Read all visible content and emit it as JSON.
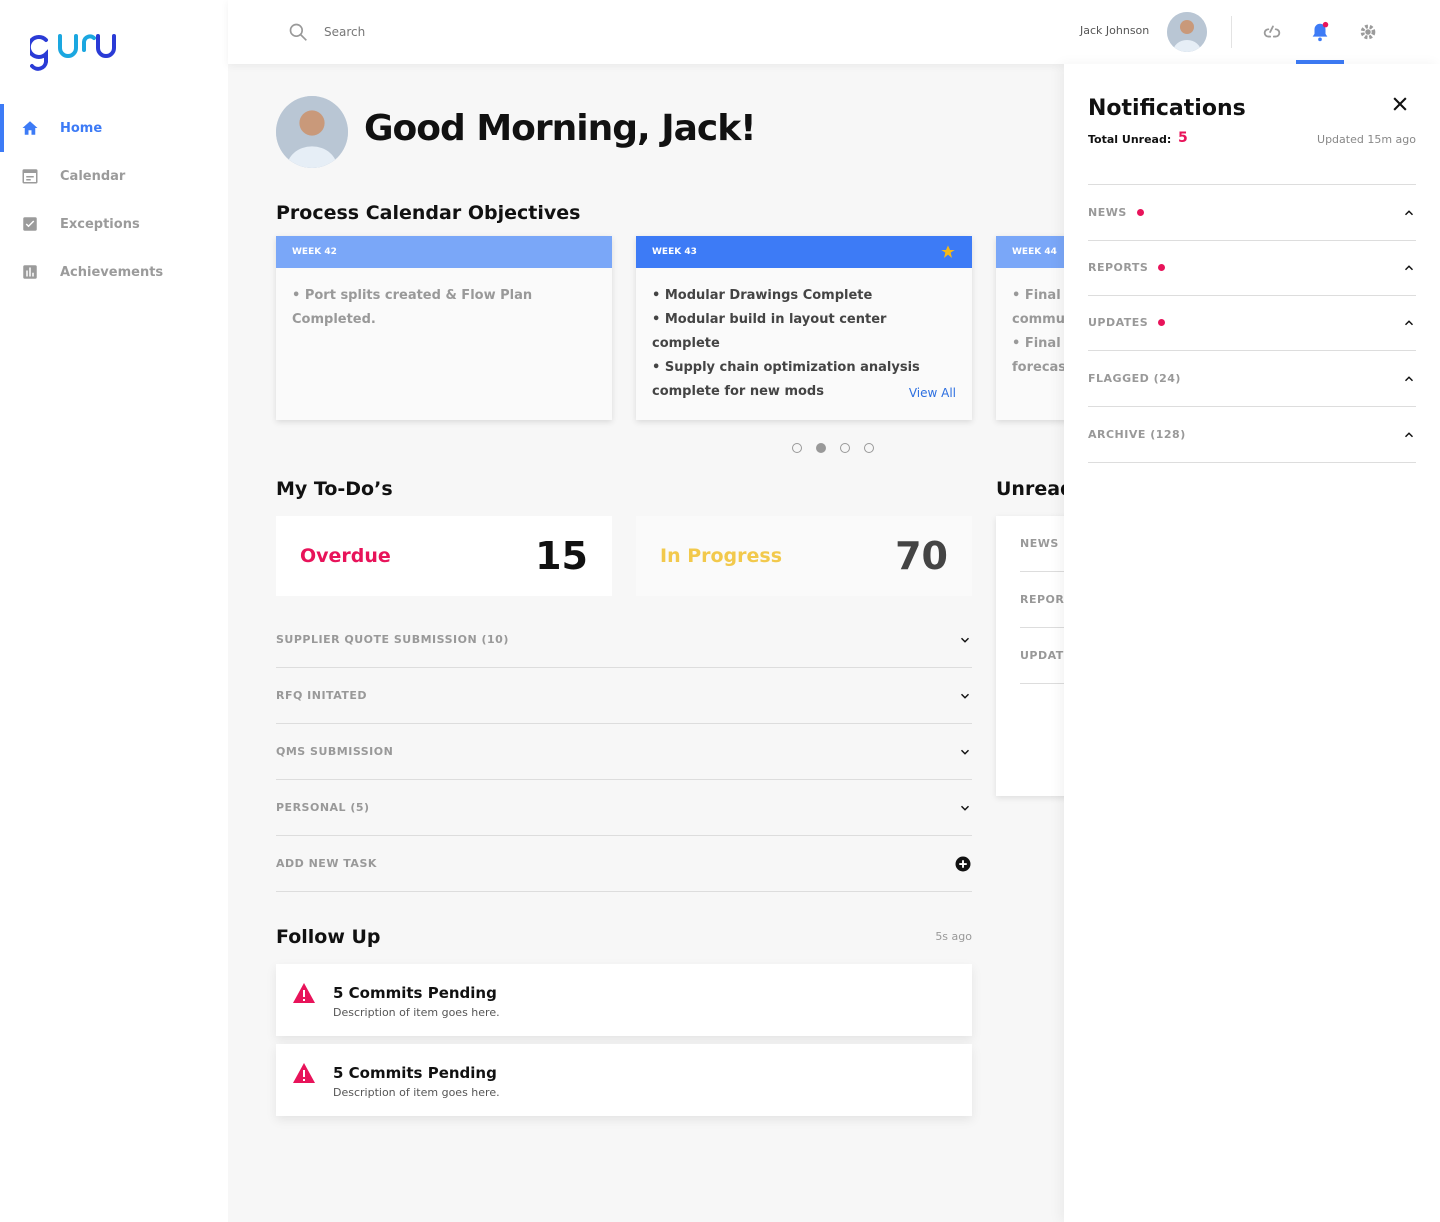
{
  "app": {
    "brand": "guru"
  },
  "colors": {
    "accent": "#3d7bf6",
    "overdue": "#e8135a",
    "in_progress": "#f2c94c",
    "alert": "#e8135a"
  },
  "sidebar": {
    "items": [
      {
        "label": "Home",
        "icon": "home-icon",
        "active": true
      },
      {
        "label": "Calendar",
        "icon": "calendar-icon",
        "active": false
      },
      {
        "label": "Exceptions",
        "icon": "checkbox-icon",
        "active": false
      },
      {
        "label": "Achievements",
        "icon": "bar-chart-icon",
        "active": false
      }
    ]
  },
  "topbar": {
    "search_placeholder": "Search",
    "user_name": "Jack Johnson",
    "icons": [
      "link-icon",
      "bell-icon",
      "gear-icon"
    ]
  },
  "main": {
    "greeting": "Good Morning, Jack!",
    "objectives": {
      "title": "Process Calendar Objectives",
      "weeks": [
        {
          "label": "WEEK 42",
          "items": [
            "• Port splits created & Flow Plan Completed."
          ]
        },
        {
          "label": "WEEK 43",
          "starred": true,
          "items": [
            "• Modular Drawings Complete",
            "• Modular build in layout center complete",
            "• Supply chain optimization analysis complete for new mods"
          ],
          "view_all": "View All"
        },
        {
          "label": "WEEK 44",
          "items": [
            "• Final I",
            "commu",
            "• Final I",
            "forecas"
          ]
        }
      ],
      "pages": 4,
      "current_page": 2
    },
    "todos": {
      "title": "My To-Do’s",
      "overdue_label": "Overdue",
      "overdue_count": "15",
      "in_progress_label": "In Progress",
      "in_progress_count": "70",
      "rows": [
        "SUPPLIER QUOTE SUBMISSION (10)",
        "RFQ INITATED",
        "QMS SUBMISSION",
        "PERSONAL (5)"
      ],
      "add_task": "ADD NEW TASK"
    },
    "unread": {
      "title": "Unread",
      "rows": [
        "NEWS",
        "REPOR",
        "UPDAT"
      ]
    },
    "follow_up": {
      "title": "Follow Up",
      "time": "5s ago",
      "items": [
        {
          "title": "5 Commits Pending",
          "desc": "Description of item goes here."
        },
        {
          "title": "5 Commits Pending",
          "desc": "Description of item goes here."
        }
      ]
    }
  },
  "notifications": {
    "title": "Notifications",
    "unread_label": "Total Unread:",
    "unread_count": "5",
    "updated": "Updated 15m ago",
    "rows": [
      {
        "label": "NEWS",
        "dot": true
      },
      {
        "label": "REPORTS",
        "dot": true
      },
      {
        "label": "UPDATES",
        "dot": true
      },
      {
        "label": "FLAGGED (24)",
        "dot": false
      },
      {
        "label": "ARCHIVE (128)",
        "dot": false
      }
    ]
  }
}
